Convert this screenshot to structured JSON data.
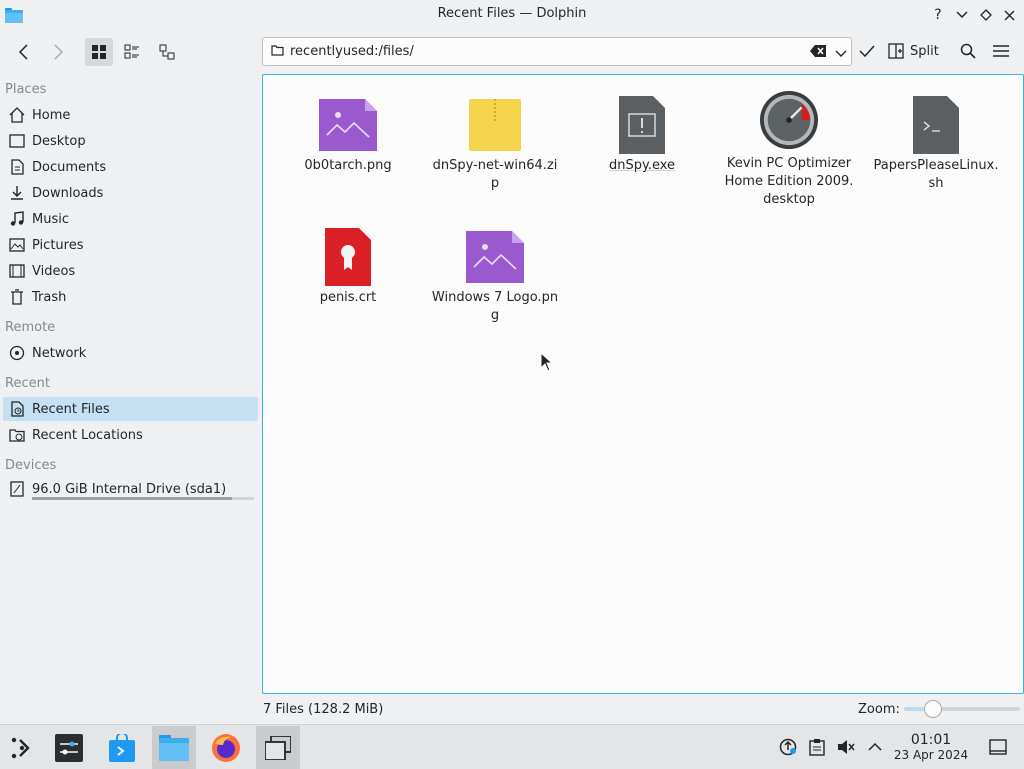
{
  "window": {
    "title": "Recent Files — Dolphin",
    "icon": "dolphin-folder-icon",
    "controls": [
      "help-icon",
      "minimize-icon",
      "maximize-icon",
      "close-icon"
    ]
  },
  "toolbar": {
    "back_icon": "back-arrow-icon",
    "forward_icon": "forward-arrow-icon",
    "views": [
      "icons-view-icon",
      "compact-view-icon",
      "details-view-icon"
    ],
    "active_view": "icons-view-icon",
    "location": "recentlyused:/files/",
    "split_label": "Split",
    "search_icon": "search-icon",
    "menu_icon": "hamburger-menu-icon"
  },
  "places": {
    "sections": [
      {
        "title": "Places",
        "items": [
          {
            "label": "Home",
            "icon": "home-icon"
          },
          {
            "label": "Desktop",
            "icon": "desktop-icon"
          },
          {
            "label": "Documents",
            "icon": "documents-icon"
          },
          {
            "label": "Downloads",
            "icon": "downloads-icon"
          },
          {
            "label": "Music",
            "icon": "music-icon"
          },
          {
            "label": "Pictures",
            "icon": "pictures-icon"
          },
          {
            "label": "Videos",
            "icon": "videos-icon"
          },
          {
            "label": "Trash",
            "icon": "trash-icon"
          }
        ]
      },
      {
        "title": "Remote",
        "items": [
          {
            "label": "Network",
            "icon": "network-icon"
          }
        ]
      },
      {
        "title": "Recent",
        "items": [
          {
            "label": "Recent Files",
            "icon": "recent-files-icon",
            "selected": true
          },
          {
            "label": "Recent Locations",
            "icon": "recent-locations-icon"
          }
        ]
      },
      {
        "title": "Devices",
        "items": [
          {
            "label": "96.0 GiB Internal Drive (sda1)",
            "icon": "drive-icon",
            "usage": 0.9
          }
        ]
      }
    ]
  },
  "files": [
    {
      "name": "0b0tarch.png",
      "icon": "image-file-icon"
    },
    {
      "name": "dnSpy-net-win64.zip",
      "icon": "zip-archive-icon"
    },
    {
      "name": "dnSpy.exe",
      "icon": "executable-file-icon"
    },
    {
      "name": "Kevin PC Optimizer Home Edition 2009.desktop",
      "icon": "speedometer-app-icon"
    },
    {
      "name": "PapersPleaseLinux.sh",
      "icon": "shell-script-icon"
    },
    {
      "name": "penis.crt",
      "icon": "certificate-file-icon"
    },
    {
      "name": "Windows 7 Logo.png",
      "icon": "image-file-icon"
    }
  ],
  "status": {
    "summary": "7 Files (128.2 MiB)",
    "zoom_label": "Zoom:",
    "zoom_level": 0.2
  },
  "taskbar": {
    "launcher_icon": "app-launcher-icon",
    "tasks": [
      {
        "name": "settings-task-icon"
      },
      {
        "name": "discover-store-task-icon"
      },
      {
        "name": "dolphin-task-icon",
        "active": true
      },
      {
        "name": "firefox-task-icon"
      },
      {
        "name": "window-overview-task-icon",
        "active": true
      }
    ],
    "tray": [
      "updates-icon",
      "clipboard-icon",
      "volume-muted-icon",
      "expand-tray-icon"
    ],
    "time": "01:01",
    "date": "23 Apr 2024",
    "show_desktop_icon": "show-desktop-icon"
  },
  "colors": {
    "selection": "#c5dff3",
    "focus_border": "#3daee9",
    "image_file": "#9b59d0",
    "zip": "#f5d34b",
    "exe": "#5b5f62",
    "cert": "#da2027"
  }
}
